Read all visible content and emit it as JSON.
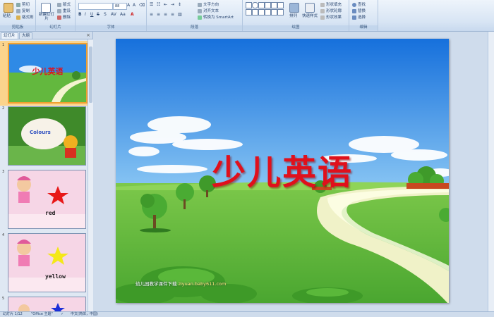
{
  "ribbon": {
    "clipboard": {
      "paste": "粘贴",
      "cut": "剪切",
      "copy": "复制",
      "format_painter": "格式刷",
      "label": "剪贴板"
    },
    "slides": {
      "new_slide": "新建幻灯片",
      "layout": "版式",
      "reset": "重设",
      "delete": "删除",
      "label": "幻灯片"
    },
    "font": {
      "font_name": "",
      "font_size": "88",
      "label": "字体"
    },
    "paragraph": {
      "text_direction": "文字方向",
      "align_text": "对齐文本",
      "convert_smartart": "转换为 SmartArt",
      "label": "段落"
    },
    "drawing": {
      "arrange": "排列",
      "quick_styles": "快速样式",
      "shape_fill": "形状填充",
      "shape_outline": "形状轮廓",
      "shape_effects": "形状效果",
      "label": "绘图"
    },
    "editing": {
      "find": "查找",
      "replace": "替换",
      "select": "选择",
      "label": "编辑"
    }
  },
  "panel": {
    "tab_slides": "幻灯片",
    "tab_outline": "大纲",
    "close": "×",
    "thumbnails": [
      {
        "num": "1",
        "title": "少儿英语"
      },
      {
        "num": "2",
        "title": "Colours"
      },
      {
        "num": "3",
        "title": "red"
      },
      {
        "num": "4",
        "title": "yellow"
      },
      {
        "num": "5",
        "title": ""
      }
    ]
  },
  "slide": {
    "title": "少儿英语",
    "credit_text": "幼儿园教学课件下载",
    "credit_url": "ziyuan.baby611.com"
  },
  "status": {
    "slide_count": "幻灯片 1/12",
    "theme": "\"Office 主题\"",
    "language": "中文(简体，中国)"
  },
  "colors": {
    "title_red": "#e0101c",
    "sky": "#1a78e0",
    "grass": "#5cb63a"
  }
}
